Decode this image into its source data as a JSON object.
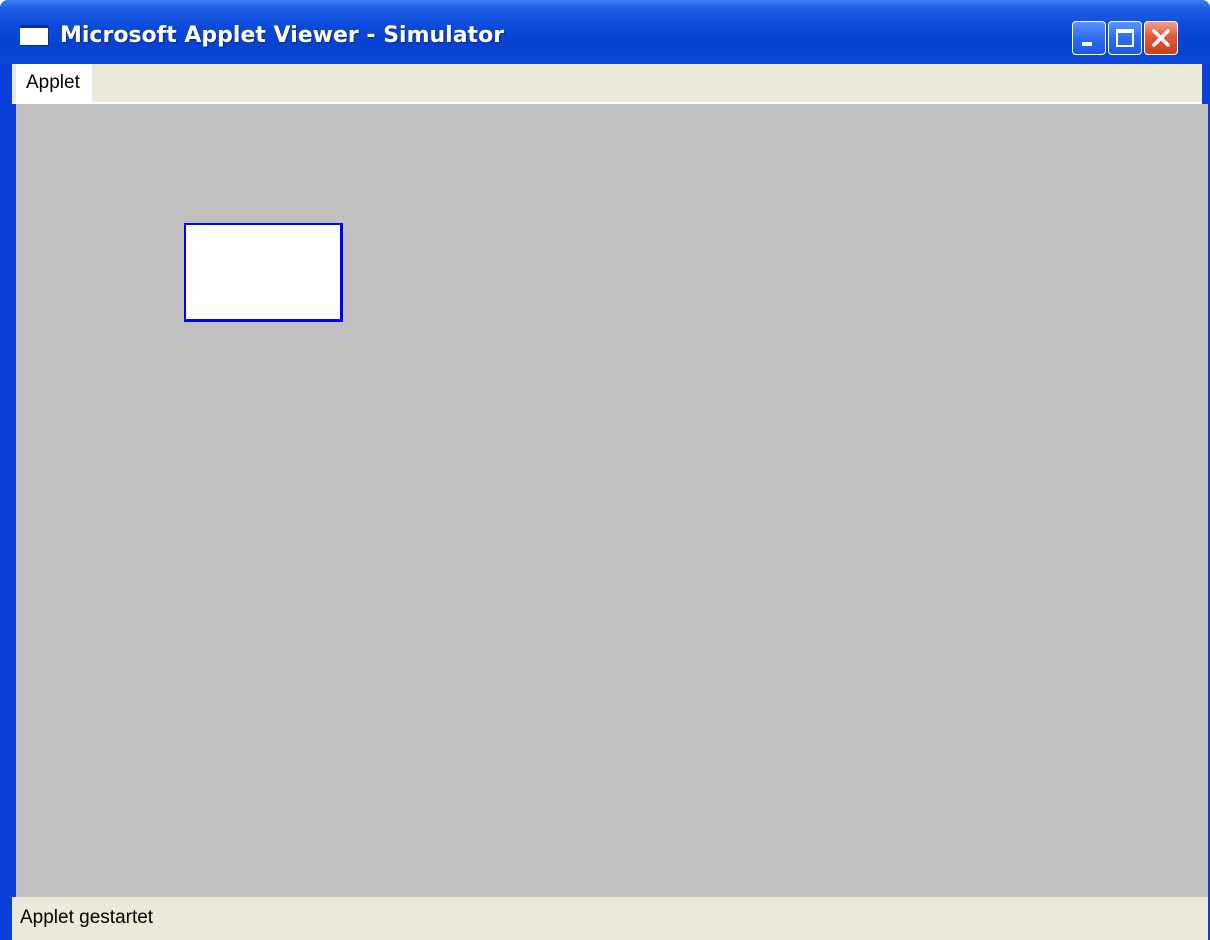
{
  "window": {
    "title": "Microsoft Applet Viewer - Simulator",
    "icon": "applet-window-icon",
    "controls": {
      "minimize_icon": "minimize-icon",
      "maximize_icon": "maximize-icon",
      "close_icon": "close-icon"
    }
  },
  "menubar": {
    "items": [
      {
        "label": "Applet"
      }
    ]
  },
  "applet": {
    "background_color": "#c0c0c0",
    "box_border_color": "#0000ff",
    "box_fill_color": "#ffffff"
  },
  "statusbar": {
    "text": "Applet gestartet"
  },
  "colors": {
    "titlebar": "#0a49d8",
    "chrome": "#ece9d8",
    "close_button": "#e25a36"
  }
}
